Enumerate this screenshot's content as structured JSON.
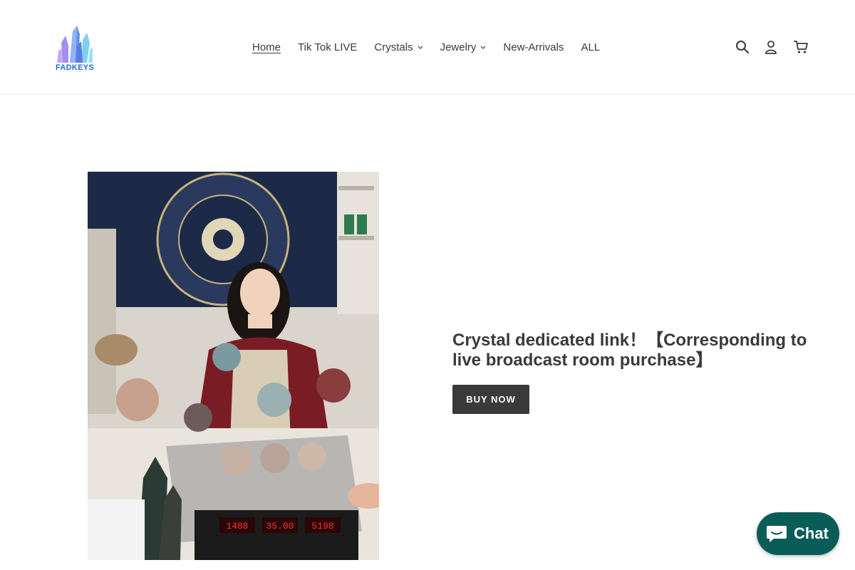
{
  "brand": {
    "logo_text": "FADKEYS",
    "accent_color": "#1d6fd0"
  },
  "nav": {
    "items": [
      {
        "label": "Home",
        "active": true,
        "dropdown": false
      },
      {
        "label": "Tik Tok LIVE",
        "active": false,
        "dropdown": false
      },
      {
        "label": "Crystals",
        "active": false,
        "dropdown": true
      },
      {
        "label": "Jewelry",
        "active": false,
        "dropdown": true
      },
      {
        "label": "New-Arrivals",
        "active": false,
        "dropdown": false
      },
      {
        "label": "ALL",
        "active": false,
        "dropdown": false
      }
    ]
  },
  "header_icons": [
    "search-icon",
    "account-icon",
    "cart-icon"
  ],
  "hero": {
    "image": {
      "scale_readouts": [
        "1488",
        "35.00",
        "5198"
      ]
    },
    "title": "Crystal dedicated link！【Corresponding to live broadcast room purchase】",
    "buy_button": "BUY NOW"
  },
  "chat_widget": {
    "label": "Chat",
    "color": "#0a5c59",
    "icon": "chat-bubble-icon"
  }
}
